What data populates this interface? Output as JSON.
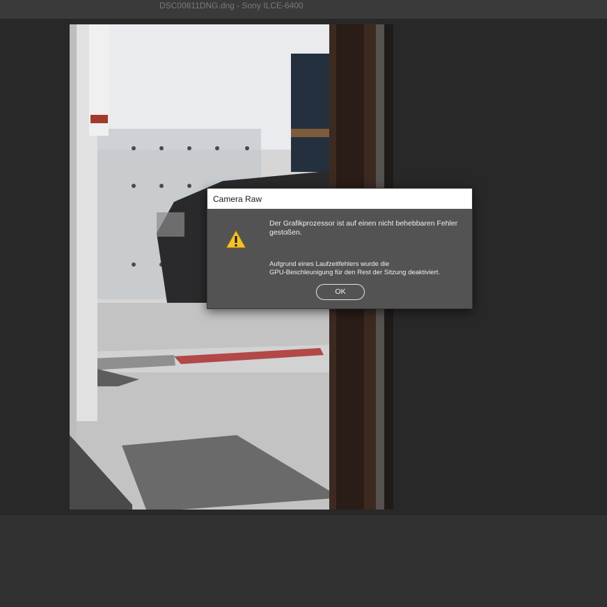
{
  "window": {
    "title": "DSC00811DNG.dng - Sony ILCE-6400"
  },
  "dialog": {
    "title": "Camera Raw",
    "message_primary": "Der Grafikprozessor ist auf einen nicht behebbaren Fehler gestoßen.",
    "message_secondary_line1": "Aufgrund eines Laufzeitfehlers wurde die",
    "message_secondary_line2": "GPU-Beschleunigung für den Rest der Sitzung deaktiviert.",
    "ok_label": "OK",
    "icon": "warning-icon"
  },
  "colors": {
    "dialog_bg": "#535353",
    "dialog_header_bg": "#ffffff",
    "app_bg": "#282828",
    "titlebar_bg": "#3a3a3a",
    "warning_yellow": "#f2c12e"
  }
}
